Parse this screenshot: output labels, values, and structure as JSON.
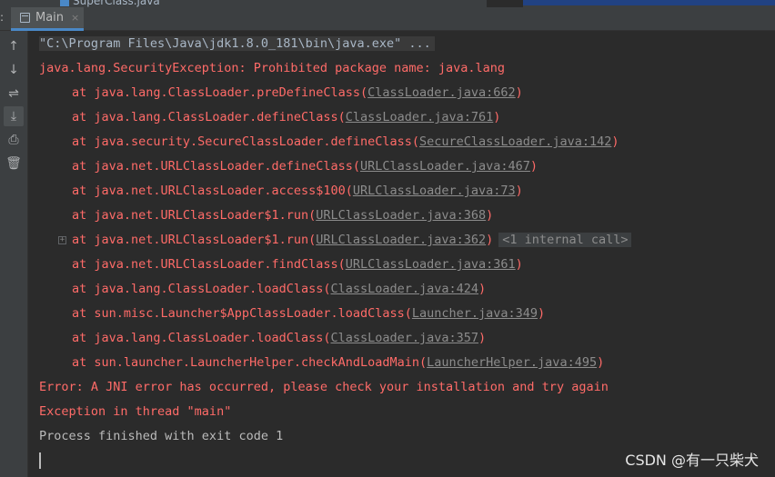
{
  "top": {
    "file_tab_label": "SuperClass.java"
  },
  "tab_bar": {
    "left_fragment": ":",
    "run_tab": {
      "label": "Main",
      "close_glyph": "×"
    }
  },
  "toolbar": {
    "buttons": [
      {
        "name": "up-arrow-icon",
        "glyph": "↑"
      },
      {
        "name": "down-arrow-icon",
        "glyph": "↓"
      },
      {
        "name": "soft-wrap-icon",
        "glyph": "⇌"
      },
      {
        "name": "scroll-to-end-icon",
        "glyph": "⤓"
      },
      {
        "name": "print-icon",
        "glyph": "⎙"
      },
      {
        "name": "trash-icon",
        "glyph": "🗑"
      }
    ]
  },
  "console": {
    "command": "\"C:\\Program Files\\Java\\jdk1.8.0_181\\bin\\java.exe\" ...",
    "exception_header": "java.lang.SecurityException: Prohibited package name: java.lang",
    "stack": [
      {
        "method": "at java.lang.ClassLoader.preDefineClass(",
        "source": "ClassLoader.java:662",
        "suffix": ")"
      },
      {
        "method": "at java.lang.ClassLoader.defineClass(",
        "source": "ClassLoader.java:761",
        "suffix": ")"
      },
      {
        "method": "at java.security.SecureClassLoader.defineClass(",
        "source": "SecureClassLoader.java:142",
        "suffix": ")"
      },
      {
        "method": "at java.net.URLClassLoader.defineClass(",
        "source": "URLClassLoader.java:467",
        "suffix": ")"
      },
      {
        "method": "at java.net.URLClassLoader.access$100(",
        "source": "URLClassLoader.java:73",
        "suffix": ")"
      },
      {
        "method": "at java.net.URLClassLoader$1.run(",
        "source": "URLClassLoader.java:368",
        "suffix": ")"
      },
      {
        "method": "at java.net.URLClassLoader$1.run(",
        "source": "URLClassLoader.java:362",
        "suffix": ")",
        "fold": "<1 internal call>"
      },
      {
        "method": "at java.net.URLClassLoader.findClass(",
        "source": "URLClassLoader.java:361",
        "suffix": ")"
      },
      {
        "method": "at java.lang.ClassLoader.loadClass(",
        "source": "ClassLoader.java:424",
        "suffix": ")"
      },
      {
        "method": "at sun.misc.Launcher$AppClassLoader.loadClass(",
        "source": "Launcher.java:349",
        "suffix": ")"
      },
      {
        "method": "at java.lang.ClassLoader.loadClass(",
        "source": "ClassLoader.java:357",
        "suffix": ")"
      },
      {
        "method": "at sun.launcher.LauncherHelper.checkAndLoadMain(",
        "source": "LauncherHelper.java:495",
        "suffix": ")"
      }
    ],
    "error_line": "Error: A JNI error has occurred, please check your installation and try again",
    "thread_line": "Exception in thread \"main\"",
    "exit_line": "Process finished with exit code 1"
  },
  "watermark": "CSDN @有一只柴犬",
  "colors": {
    "background": "#2b2b2b",
    "panel": "#3c3f41",
    "error_red": "#ff6b68",
    "text": "#bbbbbb",
    "link": "#8c8c8c",
    "accent": "#4a88c7"
  }
}
